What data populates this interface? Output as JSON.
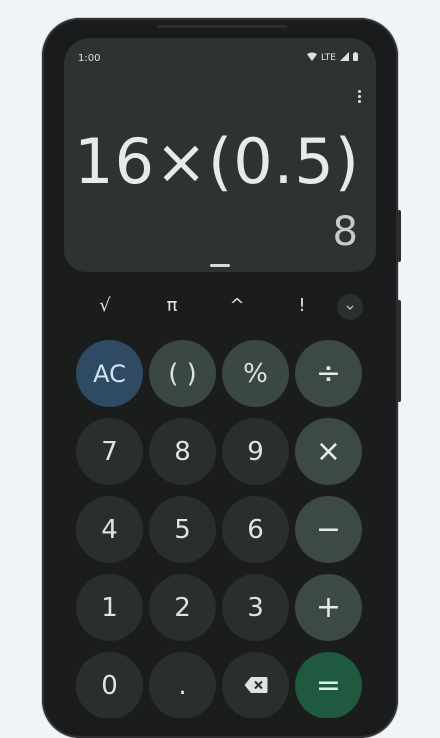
{
  "status": {
    "time": "1:00",
    "network": "LTE"
  },
  "display": {
    "expression": "16×(0.5)",
    "result": "8"
  },
  "scientific": {
    "sqrt": "√",
    "pi": "π",
    "power": "^",
    "factorial": "!"
  },
  "keys": {
    "ac": "AC",
    "parens": "( )",
    "percent": "%",
    "divide": "÷",
    "seven": "7",
    "eight": "8",
    "nine": "9",
    "multiply": "×",
    "four": "4",
    "five": "5",
    "six": "6",
    "minus": "−",
    "one": "1",
    "two": "2",
    "three": "3",
    "plus": "+",
    "zero": "0",
    "decimal": ".",
    "equals": "="
  },
  "icons": {
    "wifi": "wifi-icon",
    "signal": "signal-icon",
    "battery": "battery-icon",
    "menu": "more-vert-icon",
    "expand": "chevron-down-icon",
    "backspace": "backspace-icon"
  },
  "colors": {
    "display_bg": "#2c3330",
    "ac_key": "#2f4a63",
    "equals_key": "#1f5a40",
    "operator_key": "#3d4a43",
    "digit_key": "#2a2e2c"
  }
}
